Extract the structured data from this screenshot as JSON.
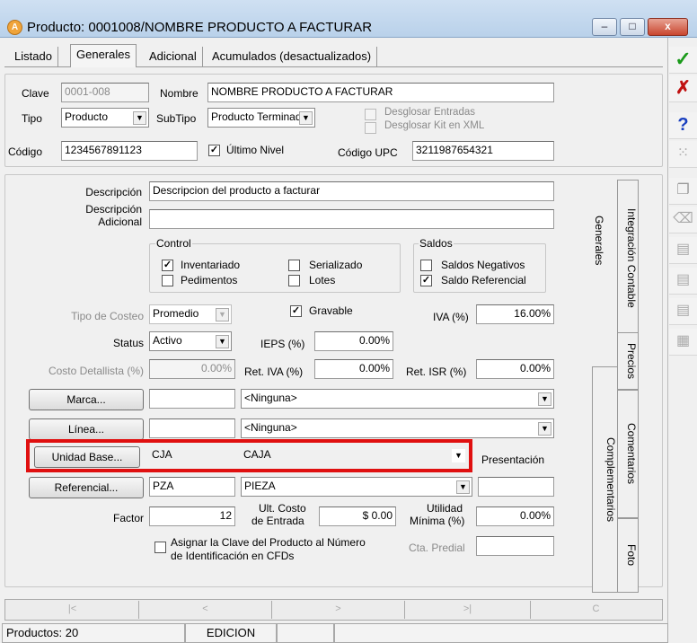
{
  "window": {
    "title": "Producto: 0001008/NOMBRE PRODUCTO A FACTURAR",
    "app_icon": "A",
    "minimize": "–",
    "maximize": "□",
    "close": "x"
  },
  "tabs": [
    "Listado",
    "Generales",
    "Adicional",
    "Acumulados (desactualizados)"
  ],
  "header": {
    "clave_label": "Clave",
    "clave_value": "0001-008",
    "nombre_label": "Nombre",
    "nombre_value": "NOMBRE PRODUCTO A FACTURAR",
    "tipo_label": "Tipo",
    "tipo_value": "Producto",
    "subtipo_label": "SubTipo",
    "subtipo_value": "Producto Terminad",
    "desglosar_entradas": "Desglosar Entradas",
    "desglosar_kit": "Desglosar Kit en XML",
    "codigo_label": "Código",
    "codigo_value": "1234567891123",
    "ultimo_nivel": "Último Nivel",
    "codigo_upc_label": "Código UPC",
    "codigo_upc_value": "3211987654321"
  },
  "general": {
    "descripcion_label": "Descripción",
    "descripcion_value": "Descripcion del producto a facturar",
    "desc_adicional_label1": "Descripción",
    "desc_adicional_label2": "Adicional",
    "control_legend": "Control",
    "inventariado": "Inventariado",
    "pedimentos": "Pedimentos",
    "serializado": "Serializado",
    "lotes": "Lotes",
    "saldos_legend": "Saldos",
    "saldos_negativos": "Saldos Negativos",
    "saldo_referencial": "Saldo Referencial",
    "tipo_costeo_label": "Tipo de Costeo",
    "tipo_costeo_value": "Promedio",
    "gravable": "Gravable",
    "iva_label": "IVA (%)",
    "iva_value": "16.00%",
    "status_label": "Status",
    "status_value": "Activo",
    "ieps_label": "IEPS (%)",
    "ieps_value": "0.00%",
    "costo_detallista_label": "Costo Detallista (%)",
    "costo_detallista_value": "0.00%",
    "ret_iva_label": "Ret. IVA (%)",
    "ret_iva_value": "0.00%",
    "ret_isr_label": "Ret. ISR (%)",
    "ret_isr_value": "0.00%",
    "marca_btn": "Marca...",
    "marca_value": "<Ninguna>",
    "linea_btn": "Línea...",
    "linea_value": "<Ninguna>",
    "unidad_base_btn": "Unidad Base...",
    "unidad_base_code": "CJA",
    "unidad_base_value": "CAJA",
    "presentacion_label": "Presentación",
    "referencial_btn": "Referencial...",
    "referencial_code": "PZA",
    "referencial_value": "PIEZA",
    "factor_label": "Factor",
    "factor_value": "12",
    "ult_costo_label1": "Ult. Costo",
    "ult_costo_label2": "de Entrada",
    "ult_costo_value": "$ 0.00",
    "utilidad_label1": "Utilidad",
    "utilidad_label2": "Mínima (%)",
    "utilidad_value": "0.00%",
    "asignar_clave_1": "Asignar la Clave del Producto al Número",
    "asignar_clave_2": "de Identificación en CFDs",
    "cta_predial_label": "Cta. Predial"
  },
  "side_tabs": [
    "Generales",
    "Integración Contable",
    "Precios",
    "Complementarios",
    "Comentarios",
    "Foto"
  ],
  "toolbar": [
    "check-icon",
    "close-x-icon",
    "help-icon",
    "dotted-grid-icon",
    "copy-icon",
    "trash-icon",
    "print-icon",
    "print-icon",
    "print-icon",
    "calculator-icon"
  ],
  "nav": [
    "|<",
    "<",
    ">",
    ">|",
    "C"
  ],
  "status": {
    "productos": "Productos: 20",
    "mode": "EDICION"
  },
  "colors": {
    "highlight": "#e01010",
    "check": "#1a9a1a",
    "cancel": "#c01010",
    "help": "#1a40c0"
  }
}
